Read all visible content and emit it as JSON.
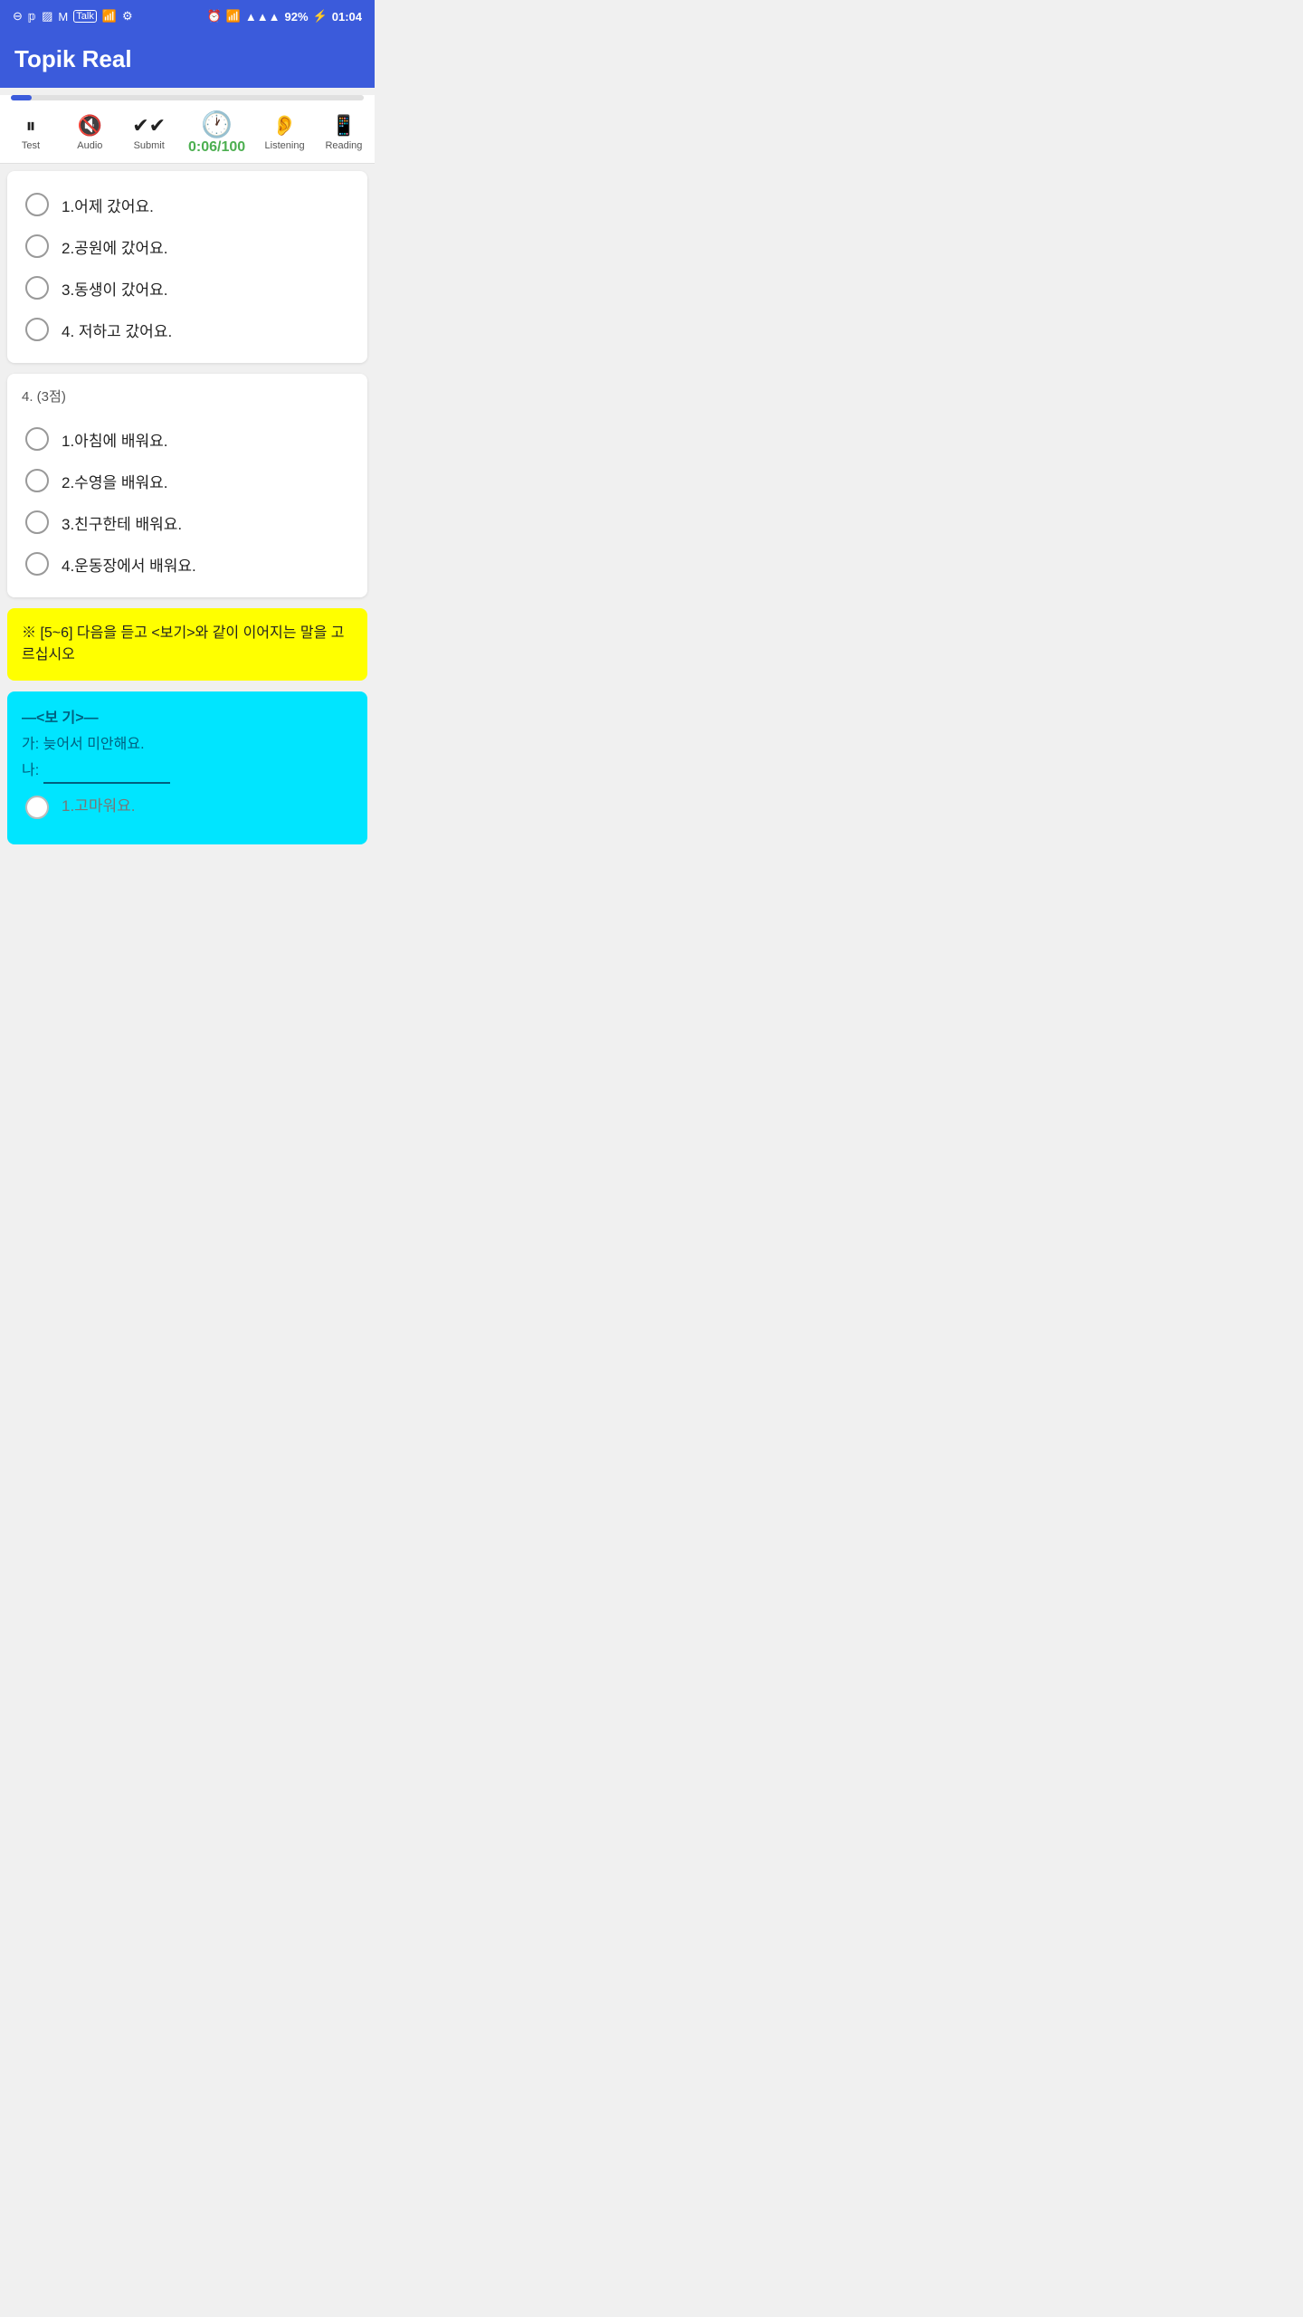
{
  "statusBar": {
    "leftIcons": [
      "⊖",
      "℗",
      "🖼",
      "M",
      "Talk",
      "WiFi",
      "⚙"
    ],
    "battery": "92%",
    "time": "01:04",
    "signal": "▲▲▲"
  },
  "appBar": {
    "title": "Topik Real"
  },
  "toolbar": {
    "progressPercent": 6,
    "testLabel": "Test",
    "audioLabel": "Audio",
    "submitLabel": "Submit",
    "timerDisplay": "0:06/100",
    "listeningLabel": "Listening",
    "readingLabel": "Reading"
  },
  "question3": {
    "options": [
      {
        "id": "3-1",
        "text": "1.어제 갔어요."
      },
      {
        "id": "3-2",
        "text": "2.공원에 갔어요."
      },
      {
        "id": "3-3",
        "text": "3.동생이 갔어요."
      },
      {
        "id": "3-4",
        "text": "4. 저하고 갔어요."
      }
    ]
  },
  "question4": {
    "header": "4.  (3점)",
    "options": [
      {
        "id": "4-1",
        "text": "1.아침에 배워요."
      },
      {
        "id": "4-2",
        "text": "2.수영을 배워요."
      },
      {
        "id": "4-3",
        "text": "3.친구한테 배워요."
      },
      {
        "id": "4-4",
        "text": "4.운동장에서 배워요."
      }
    ]
  },
  "sectionInstruction": {
    "text": "※ [5~6] 다음을 듣고 <보기>와 같이 이어지는 말을 고르십시오"
  },
  "exampleBox": {
    "title": "—<보 기>—",
    "lineA": "가: 늦어서 미안해요.",
    "lineB": "나: ",
    "firstOption": "1.고마워요."
  }
}
